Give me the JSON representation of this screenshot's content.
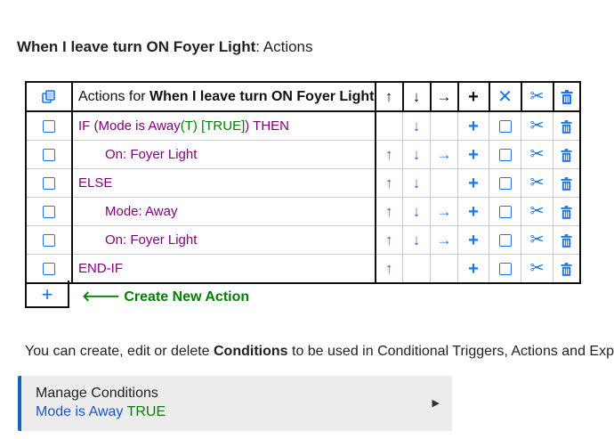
{
  "header": {
    "title_bold": "When I leave turn ON Foyer Light",
    "title_suffix": ": Actions"
  },
  "table": {
    "header_prefix": "Actions for ",
    "header_bold": "When I leave turn ON Foyer Light",
    "header_icons": [
      "copy-icon",
      "up-arrow-icon",
      "down-arrow-icon",
      "right-arrow-icon",
      "plus-icon",
      "close-icon",
      "scissors-icon",
      "trash-icon"
    ],
    "rows": [
      {
        "parts": [
          {
            "text": "IF (Mode is Away",
            "color": "purple"
          },
          {
            "text": "(T) [TRUE]",
            "color": "green"
          },
          {
            "text": ") THEN",
            "color": "purple"
          }
        ],
        "indent": false,
        "up": false,
        "down": true,
        "right": false
      },
      {
        "parts": [
          {
            "text": "On: Foyer Light",
            "color": "purple"
          }
        ],
        "indent": true,
        "up": true,
        "down": true,
        "right": true
      },
      {
        "parts": [
          {
            "text": "ELSE",
            "color": "purple"
          }
        ],
        "indent": false,
        "up": true,
        "down": true,
        "right": false
      },
      {
        "parts": [
          {
            "text": "Mode: Away",
            "color": "purple"
          }
        ],
        "indent": true,
        "up": true,
        "down": true,
        "right": true
      },
      {
        "parts": [
          {
            "text": "On: Foyer Light",
            "color": "purple"
          }
        ],
        "indent": true,
        "up": true,
        "down": true,
        "right": true
      },
      {
        "parts": [
          {
            "text": "END-IF",
            "color": "purple"
          }
        ],
        "indent": false,
        "up": true,
        "down": false,
        "right": false
      }
    ]
  },
  "create_action": {
    "label": "Create New Action"
  },
  "conditions": {
    "text_before": "You can create, edit or delete ",
    "text_bold": "Conditions",
    "text_after": " to be used in Conditional Triggers, Actions and Express"
  },
  "manage_conditions": {
    "title": "Manage Conditions",
    "subtitle_mode": "Mode is Away",
    "subtitle_state": "TRUE"
  },
  "colors": {
    "purple": "#800080",
    "green": "#008000",
    "blue": "#1a73e8",
    "accent_bar": "#1565c0"
  }
}
